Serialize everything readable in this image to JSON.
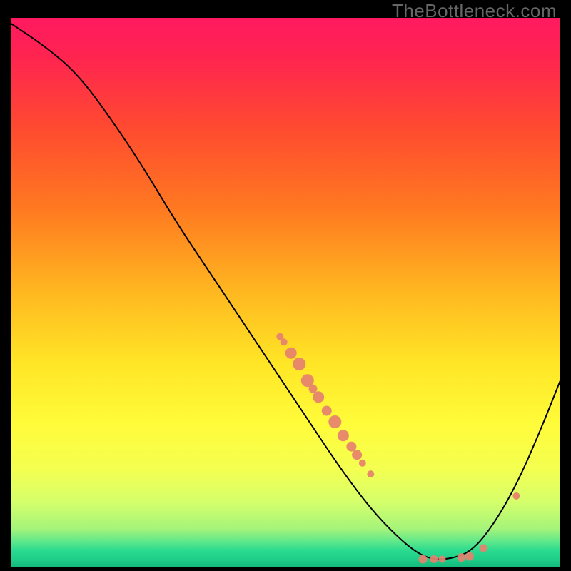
{
  "watermark": "TheBottleneck.com",
  "chart_data": {
    "type": "line",
    "title": "",
    "xlabel": "",
    "ylabel": "",
    "xlim": [
      0,
      100
    ],
    "ylim": [
      0,
      100
    ],
    "curve": [
      {
        "x": 0,
        "y": 99
      },
      {
        "x": 6,
        "y": 95
      },
      {
        "x": 12,
        "y": 90
      },
      {
        "x": 18,
        "y": 82
      },
      {
        "x": 24,
        "y": 73
      },
      {
        "x": 30,
        "y": 63
      },
      {
        "x": 36,
        "y": 54
      },
      {
        "x": 42,
        "y": 45
      },
      {
        "x": 48,
        "y": 36
      },
      {
        "x": 54,
        "y": 27
      },
      {
        "x": 60,
        "y": 18
      },
      {
        "x": 66,
        "y": 10
      },
      {
        "x": 72,
        "y": 4
      },
      {
        "x": 76,
        "y": 1.5
      },
      {
        "x": 80,
        "y": 1.5
      },
      {
        "x": 84,
        "y": 3
      },
      {
        "x": 88,
        "y": 8
      },
      {
        "x": 92,
        "y": 15
      },
      {
        "x": 96,
        "y": 24
      },
      {
        "x": 100,
        "y": 34
      }
    ],
    "markers": [
      {
        "x": 49,
        "y": 42,
        "r": 5
      },
      {
        "x": 49.7,
        "y": 41,
        "r": 5
      },
      {
        "x": 51,
        "y": 39,
        "r": 8
      },
      {
        "x": 52.5,
        "y": 37,
        "r": 9
      },
      {
        "x": 54,
        "y": 34,
        "r": 9
      },
      {
        "x": 55,
        "y": 32.5,
        "r": 6
      },
      {
        "x": 56,
        "y": 31,
        "r": 8
      },
      {
        "x": 57.5,
        "y": 28.5,
        "r": 7
      },
      {
        "x": 59,
        "y": 26.5,
        "r": 9
      },
      {
        "x": 60.5,
        "y": 24,
        "r": 8
      },
      {
        "x": 62,
        "y": 22,
        "r": 7
      },
      {
        "x": 63,
        "y": 20.5,
        "r": 7
      },
      {
        "x": 64,
        "y": 19,
        "r": 5
      },
      {
        "x": 65.5,
        "y": 17,
        "r": 5
      },
      {
        "x": 75,
        "y": 1.5,
        "r": 6
      },
      {
        "x": 77,
        "y": 1.5,
        "r": 5.5
      },
      {
        "x": 78.5,
        "y": 1.5,
        "r": 5
      },
      {
        "x": 82,
        "y": 1.8,
        "r": 6
      },
      {
        "x": 83.5,
        "y": 2,
        "r": 6
      },
      {
        "x": 86,
        "y": 3.5,
        "r": 5.5
      },
      {
        "x": 92,
        "y": 13,
        "r": 5
      }
    ],
    "gradient_stops": [
      {
        "offset": 0.0,
        "color": "#ff1a60"
      },
      {
        "offset": 0.07,
        "color": "#ff2450"
      },
      {
        "offset": 0.2,
        "color": "#ff4a30"
      },
      {
        "offset": 0.35,
        "color": "#ff7a20"
      },
      {
        "offset": 0.5,
        "color": "#ffb820"
      },
      {
        "offset": 0.63,
        "color": "#ffe626"
      },
      {
        "offset": 0.74,
        "color": "#fffc3a"
      },
      {
        "offset": 0.82,
        "color": "#f4ff50"
      },
      {
        "offset": 0.88,
        "color": "#d6ff6a"
      },
      {
        "offset": 0.93,
        "color": "#a4f47a"
      },
      {
        "offset": 0.955,
        "color": "#58e68c"
      },
      {
        "offset": 0.97,
        "color": "#28da8e"
      },
      {
        "offset": 0.985,
        "color": "#1fce88"
      },
      {
        "offset": 1.0,
        "color": "#12b87c"
      }
    ],
    "marker_color": "#e5816f",
    "curve_color": "#000000"
  }
}
